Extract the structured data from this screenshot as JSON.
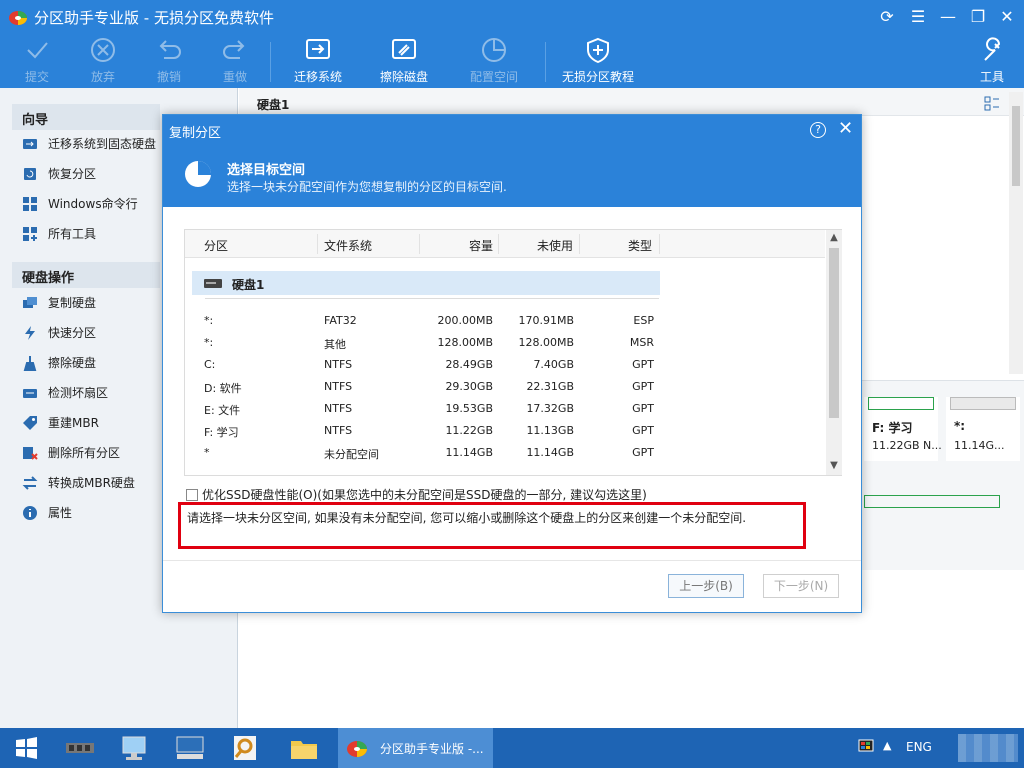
{
  "app": {
    "title": "分区助手专业版 - 无损分区免费软件",
    "controls": [
      "refresh-icon",
      "menu-icon",
      "minimize-icon",
      "restore-icon",
      "close-icon"
    ]
  },
  "toolbar": {
    "commit": "提交",
    "discard": "放弃",
    "undo": "撤销",
    "redo": "重做",
    "migrate": "迁移系统",
    "wipe": "擦除磁盘",
    "allocate": "配置空间",
    "tutorial": "无损分区教程",
    "tools": "工具"
  },
  "sidebar": {
    "wizard_title": "向导",
    "wizard_items": [
      {
        "label": "迁移系统到固态硬盘",
        "icon": "migrate-icon"
      },
      {
        "label": "恢复分区",
        "icon": "recover-icon"
      },
      {
        "label": "Windows命令行",
        "icon": "windows-icon"
      },
      {
        "label": "所有工具",
        "icon": "grid-icon"
      }
    ],
    "disk_title": "硬盘操作",
    "disk_items": [
      {
        "label": "复制硬盘",
        "icon": "copy-disk-icon"
      },
      {
        "label": "快速分区",
        "icon": "lightning-icon"
      },
      {
        "label": "擦除硬盘",
        "icon": "broom-icon"
      },
      {
        "label": "检测坏扇区",
        "icon": "scan-icon"
      },
      {
        "label": "重建MBR",
        "icon": "tag-icon"
      },
      {
        "label": "删除所有分区",
        "icon": "delete-icon"
      },
      {
        "label": "转换成MBR硬盘",
        "icon": "convert-icon"
      },
      {
        "label": "属性",
        "icon": "info-icon"
      }
    ]
  },
  "main": {
    "disk_label": "硬盘1",
    "cards": [
      {
        "name": "F: 学习",
        "size": "11.22GB N..."
      },
      {
        "name": "*:",
        "size": "11.14G..."
      }
    ]
  },
  "dialog": {
    "title": "复制分区",
    "heading": "选择目标空间",
    "subheading": "选择一块未分配空间作为您想复制的分区的目标空间.",
    "columns": [
      "分区",
      "文件系统",
      "容量",
      "未使用",
      "类型"
    ],
    "disk_name": "硬盘1",
    "rows": [
      {
        "partition": "*:",
        "fs": "FAT32",
        "capacity": "200.00MB",
        "unused": "170.91MB",
        "type": "ESP"
      },
      {
        "partition": "*:",
        "fs": "其他",
        "capacity": "128.00MB",
        "unused": "128.00MB",
        "type": "MSR"
      },
      {
        "partition": "C:",
        "fs": "NTFS",
        "capacity": "28.49GB",
        "unused": "7.40GB",
        "type": "GPT"
      },
      {
        "partition": "D: 软件",
        "fs": "NTFS",
        "capacity": "29.30GB",
        "unused": "22.31GB",
        "type": "GPT"
      },
      {
        "partition": "E: 文件",
        "fs": "NTFS",
        "capacity": "19.53GB",
        "unused": "17.32GB",
        "type": "GPT"
      },
      {
        "partition": "F: 学习",
        "fs": "NTFS",
        "capacity": "11.22GB",
        "unused": "11.13GB",
        "type": "GPT"
      },
      {
        "partition": "*",
        "fs": "未分配空间",
        "capacity": "11.14GB",
        "unused": "11.14GB",
        "type": "GPT"
      }
    ],
    "ssd_option": "优化SSD硬盘性能(O)(如果您选中的未分配空间是SSD硬盘的一部分, 建议勾选这里)",
    "hint": "请选择一块未分区空间, 如果没有未分配空间, 您可以缩小或删除这个硬盘上的分区来创建一个未分配空间.",
    "back": "上一步(B)",
    "next": "下一步(N)"
  },
  "taskbar": {
    "active_title": "分区助手专业版 -...",
    "lang": "ENG"
  },
  "colors": {
    "accent": "#2b82d9",
    "taskbar": "#1e64b4",
    "highlight": "#e00010"
  }
}
